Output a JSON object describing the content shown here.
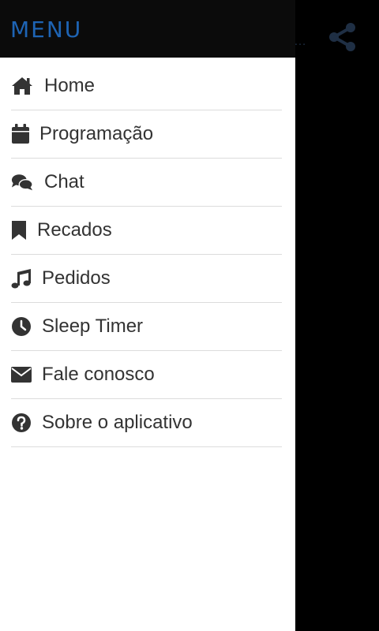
{
  "app": {
    "more_text": "…"
  },
  "drawer": {
    "title": "MENU",
    "items": [
      {
        "label": "Home",
        "icon": "home-icon"
      },
      {
        "label": "Programação",
        "icon": "calendar-icon"
      },
      {
        "label": "Chat",
        "icon": "chat-icon"
      },
      {
        "label": "Recados",
        "icon": "bookmark-icon"
      },
      {
        "label": "Pedidos",
        "icon": "music-icon"
      },
      {
        "label": "Sleep Timer",
        "icon": "clock-icon"
      },
      {
        "label": "Fale conosco",
        "icon": "envelope-icon"
      },
      {
        "label": "Sobre o aplicativo",
        "icon": "question-icon"
      }
    ]
  },
  "colors": {
    "header_bg": "#0b0b0b",
    "title": "#1e64b4",
    "icon": "#333333",
    "share_icon": "#1f2f44",
    "divider": "#dcdcdc"
  }
}
